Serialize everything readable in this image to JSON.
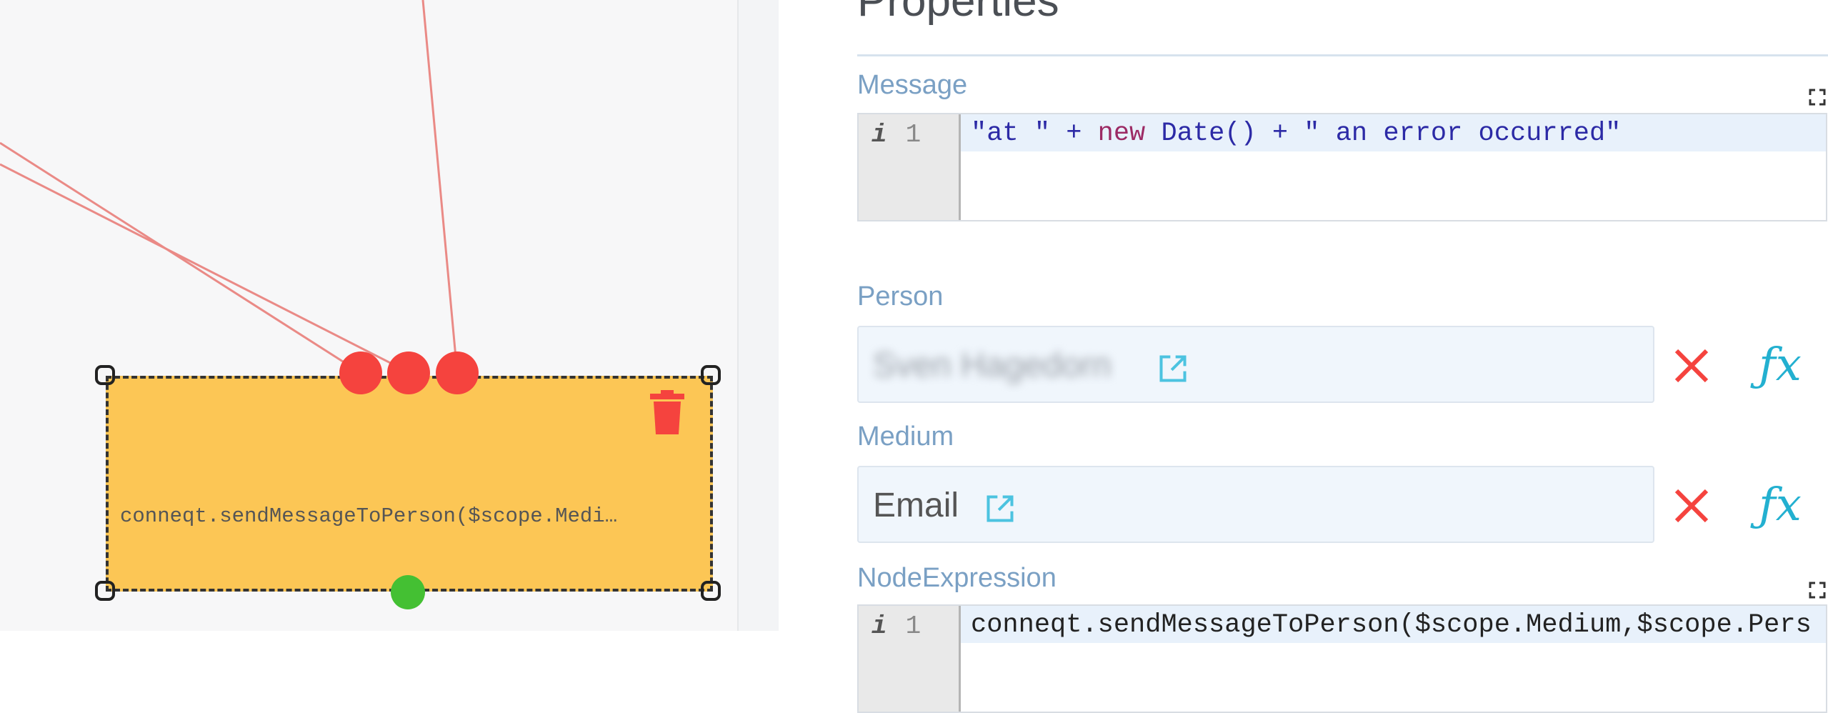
{
  "canvas": {
    "node": {
      "label": "conneqt.sendMessageToPerson($scope.Medi…",
      "color": "#fcc655"
    },
    "edge_color": "#ea8a86",
    "colors": {
      "input_port": "#f5433e",
      "output_port": "#44c033",
      "delete": "#f5433e"
    },
    "icons": {
      "delete": "trash-icon"
    }
  },
  "panel": {
    "title": "Properties",
    "message": {
      "label": "Message",
      "line_number": "1",
      "code_parts": [
        "\"at \" + ",
        "new",
        " Date() + \" an error occurred\""
      ]
    },
    "person": {
      "label": "Person",
      "value": "Sven Hagedorn"
    },
    "medium": {
      "label": "Medium",
      "value": "Email"
    },
    "node_expression": {
      "label": "NodeExpression",
      "line_number": "1",
      "code": "conneqt.sendMessageToPerson($scope.Medium,$scope.Pers"
    },
    "colors": {
      "label": "#7aa0c4",
      "clear": "#f5433e",
      "fx": "#23b0d0",
      "link": "#4cc3e0"
    },
    "icons": {
      "clear": "close-icon",
      "fx": "function-icon",
      "external": "external-link-icon",
      "expand": "fullscreen-icon",
      "info": "info-icon"
    },
    "fx_symbol": "ƒx"
  }
}
